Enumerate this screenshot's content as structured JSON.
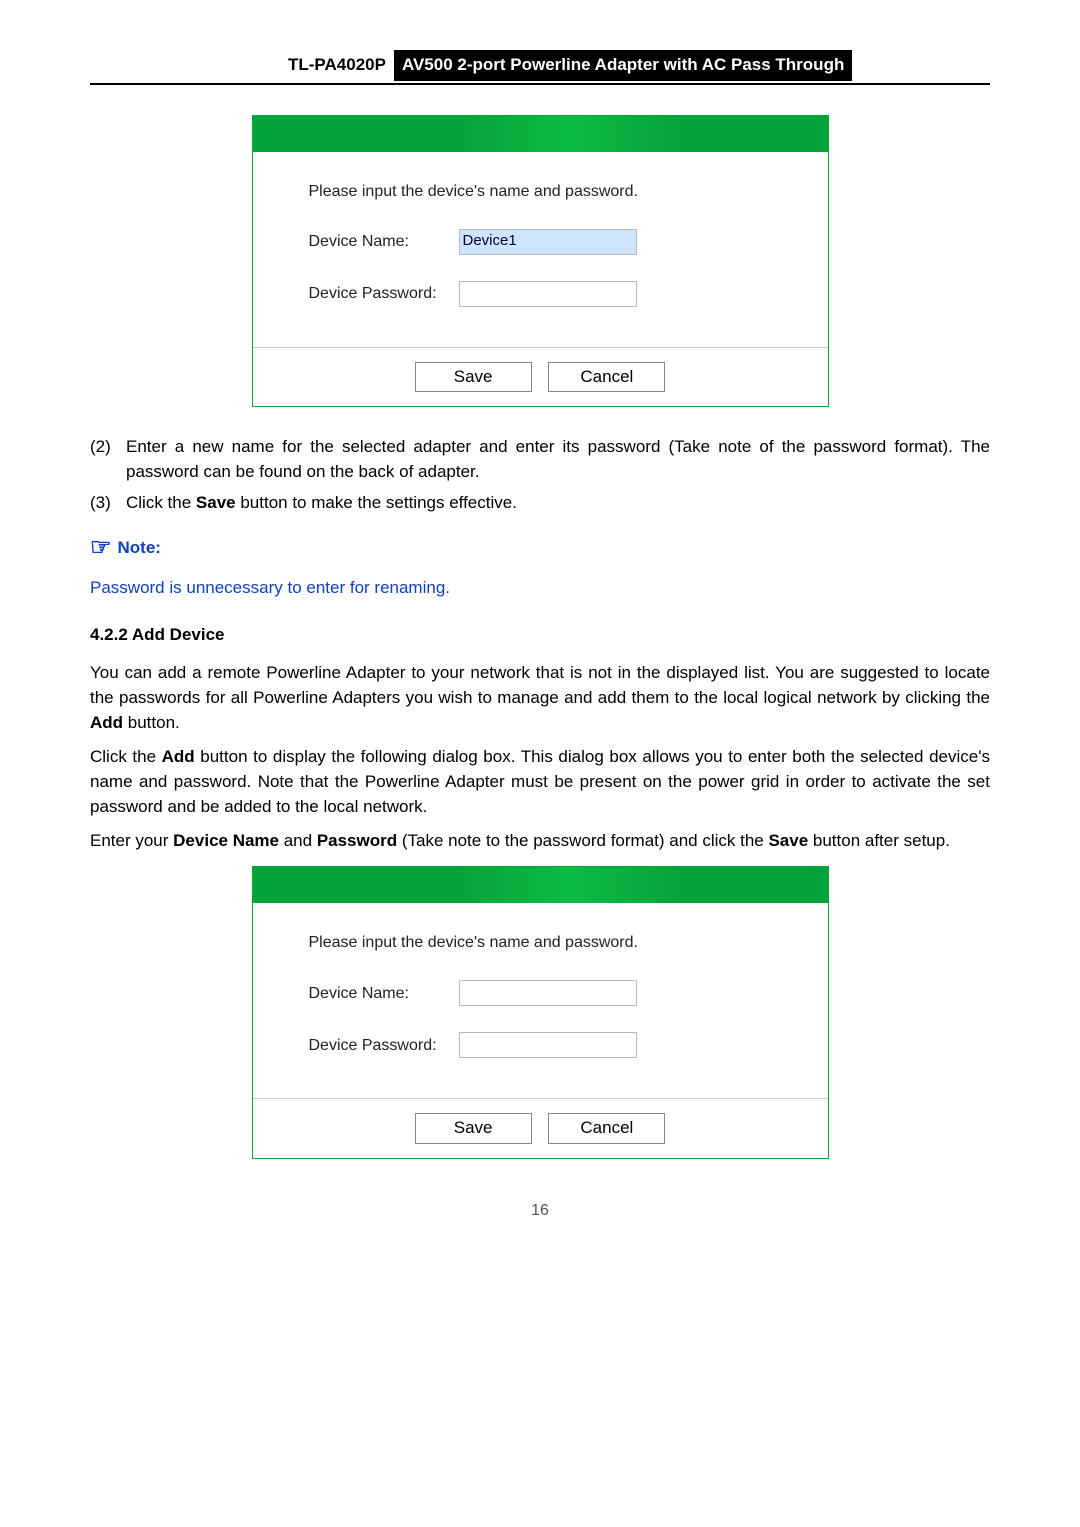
{
  "header": {
    "model": "TL-PA4020P",
    "desc": "AV500 2-port Powerline Adapter with AC Pass Through"
  },
  "dialog1": {
    "prompt": "Please input the device's name and password.",
    "name_label": "Device Name:",
    "pass_label": "Device Password:",
    "name_value": "Device1",
    "save": "Save",
    "cancel": "Cancel"
  },
  "dialog2": {
    "prompt": "Please input the device's name and password.",
    "name_label": "Device Name:",
    "pass_label": "Device Password:",
    "save": "Save",
    "cancel": "Cancel"
  },
  "steps": {
    "s2_n": "(2)",
    "s2_t_a": "Enter a new name for the selected adapter and enter its password (Take note of the password format). The password can be found on the back of adapter.",
    "s3_n": "(3)",
    "s3_t_a": "Click the ",
    "s3_t_b": "Save",
    "s3_t_c": " button to make the settings effective."
  },
  "note": {
    "icon": "☞",
    "label": "Note:",
    "body": "Password is unnecessary to enter for renaming."
  },
  "section": {
    "title": "4.2.2 Add Device",
    "p1_a": "You can add a remote Powerline Adapter to your network that is not in the displayed list. You are suggested to locate the passwords for all Powerline Adapters you wish to manage and add them to the local logical network by clicking the ",
    "p1_b": "Add",
    "p1_c": " button.",
    "p2_a": "Click the ",
    "p2_b": "Add",
    "p2_c": " button to display the following dialog box. This dialog box allows you to enter both the selected device's name and password. Note that the Powerline Adapter must be present on the power grid in order to activate the set password and be added to the local network.",
    "p3_a": "Enter your ",
    "p3_b": "Device Name",
    "p3_c": " and ",
    "p3_d": "Password",
    "p3_e": " (Take note to the password format) and click the ",
    "p3_f": "Save",
    "p3_g": " button after setup."
  },
  "page_number": "16"
}
